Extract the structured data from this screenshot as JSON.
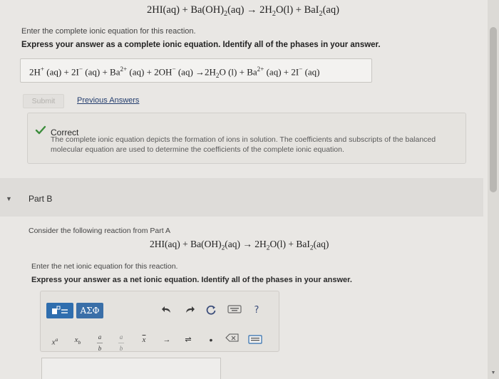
{
  "part_a": {
    "equation": "2HI(aq) + Ba(OH)₂(aq) → 2H₂O(l) + BaI₂(aq)",
    "instruction": "Enter the complete ionic equation for this reaction.",
    "express": "Express your answer as a complete ionic equation. Identify all of the phases in your answer.",
    "answer": "2H⁺ (aq) + 2I⁻ (aq) + Ba²⁺ (aq) + 2OH⁻ (aq) →2H₂O (l) + Ba²⁺ (aq) + 2I⁻ (aq)",
    "submit_label": "Submit",
    "previous_answers_label": "Previous Answers",
    "feedback": {
      "title": "Correct",
      "body": "The complete ionic equation depicts the formation of ions in solution. The coefficients and subscripts of the balanced molecular equation are used to determine the coefficients of the complete ionic equation."
    }
  },
  "part_b": {
    "label": "Part B",
    "consider": "Consider the following reaction from Part A",
    "equation": "2HI(aq) + Ba(OH)₂(aq) → 2H₂O(l) + BaI₂(aq)",
    "instruction": "Enter the net ionic equation for this reaction.",
    "express": "Express your answer as a net ionic equation. Identify all of the phases in your answer."
  },
  "toolbar": {
    "symbols_label": "ΑΣΦ",
    "help_label": "?",
    "symbols": [
      "xᵃ",
      "xₐ",
      "a/b",
      "a/b",
      "x̅",
      "→",
      "⇌",
      "•",
      "⌫",
      "⌨"
    ]
  },
  "colors": {
    "accent_blue": "#2f6eae",
    "check_green": "#3c8d3c",
    "link": "#233d6e"
  }
}
